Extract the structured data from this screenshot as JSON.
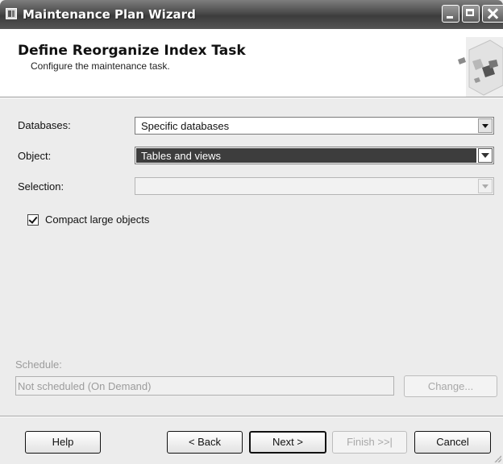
{
  "window": {
    "title": "Maintenance Plan Wizard"
  },
  "header": {
    "title": "Define Reorganize Index Task",
    "subtitle": "Configure the maintenance task."
  },
  "form": {
    "databases_label": "Databases:",
    "databases_value": "Specific databases",
    "object_label": "Object:",
    "object_value": "Tables and views",
    "selection_label": "Selection:",
    "selection_value": "",
    "compact_label": "Compact large objects",
    "compact_checked": true
  },
  "schedule": {
    "label": "Schedule:",
    "value": "Not scheduled (On Demand)",
    "change_button": "Change..."
  },
  "buttons": {
    "help": "Help",
    "back": "< Back",
    "next": "Next >",
    "finish": "Finish >>|",
    "cancel": "Cancel"
  },
  "icons": [
    "app-icon",
    "minimize-icon",
    "maximize-icon",
    "close-icon",
    "wizard-header-graphic",
    "dropdown-arrow-icon",
    "checkmark-icon",
    "resize-grip-icon"
  ]
}
